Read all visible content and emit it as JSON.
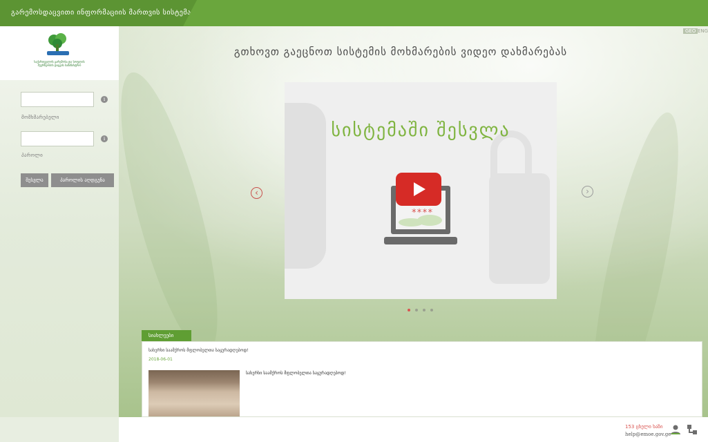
{
  "header": {
    "title": "გარემოსდაცვითი ინფორმაციის მართვის სისტემა"
  },
  "logo": {
    "org_text": "საქართველოს გარემოსა და სოფლის მეურნეობის დაცვის სამინისტრო"
  },
  "login": {
    "username_label": "მომხმარებელი",
    "password_label": "პაროლი",
    "username_value": "",
    "password_value": "",
    "info_glyph": "i",
    "login_button": "შესვლა",
    "recover_button": "პაროლის აღდგენა"
  },
  "languages": {
    "geo": "GEO",
    "eng": "ENG",
    "active": "geo"
  },
  "headline": "გთხოვთ გაეცნოთ სისტემის მოხმარების ვიდეო დახმარებას",
  "slider": {
    "slide_title": "სისტემაში შესვლა",
    "password_mask": "****",
    "prev_glyph": "‹",
    "next_glyph": "›",
    "dots": 4,
    "active_dot": 0
  },
  "news": {
    "tab_label": "სიახლეები",
    "items": [
      {
        "title": "სახერხი საამქროს მფლობელთა საყურადღებოდ!",
        "date": "2018-06-01",
        "description": "სახერხი საამქროს მფლობელთა საყურადღებოდ!"
      }
    ]
  },
  "footer": {
    "hotline": "153 ცხელი ხაზი",
    "email": "help@emoe.gov.ge"
  },
  "colors": {
    "brand_green": "#6aa63d",
    "accent_red": "#d9534f",
    "slide_green": "#7fb440"
  },
  "icons": {
    "logo": "tree-logo-icon",
    "info": "info-icon",
    "play": "play-icon",
    "laptop": "laptop-icon",
    "prev": "chevron-left-icon",
    "next": "chevron-right-icon",
    "hotline": "person-icon",
    "sitemap": "network-icon"
  }
}
